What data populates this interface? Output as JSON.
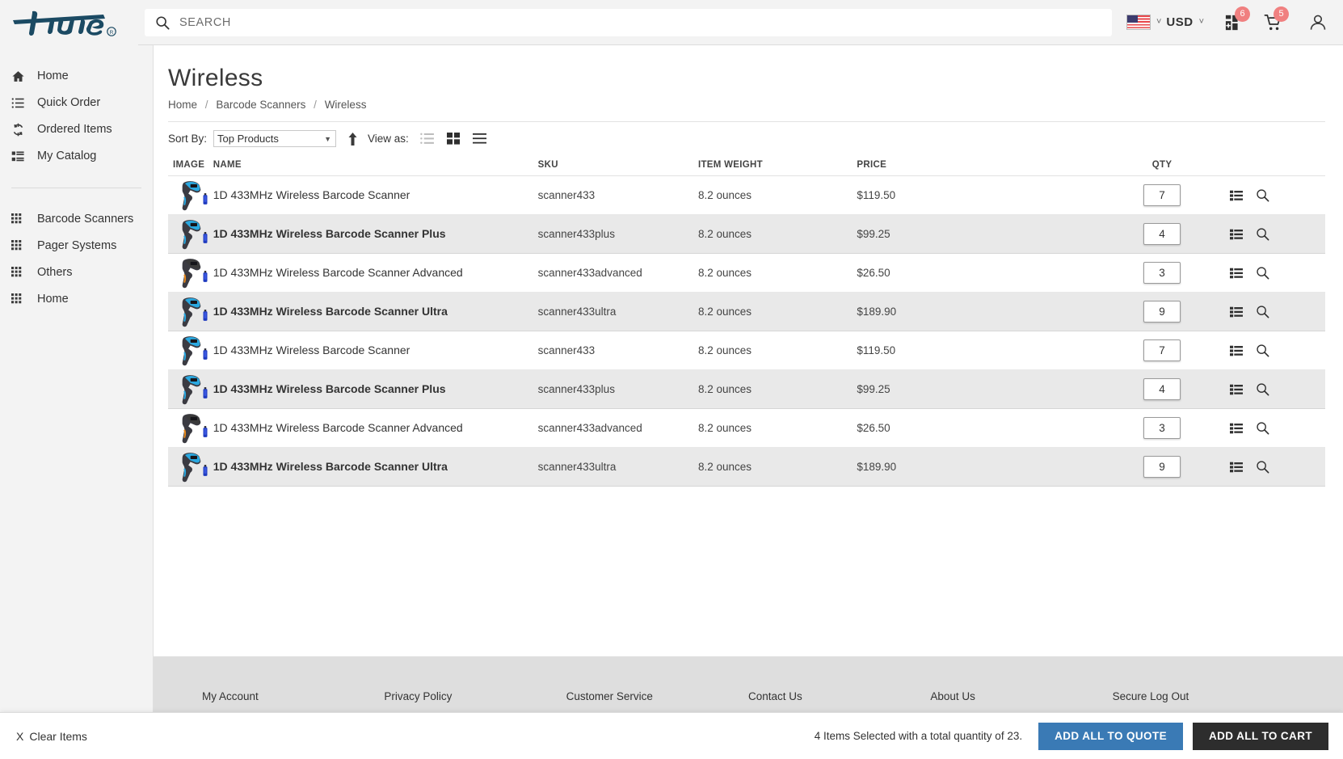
{
  "header": {
    "logo_text": "true",
    "search": {
      "placeholder": "SEARCH",
      "value": "",
      "icon": "search-icon"
    },
    "locale": {
      "flag": "us-flag-icon",
      "caret": "˅"
    },
    "currency": {
      "label": "USD",
      "caret": "˅"
    },
    "quote_badge": "6",
    "cart_badge": "5",
    "icons": {
      "quote": "quote-list-icon",
      "cart": "shopping-cart-icon",
      "account": "user-account-icon"
    }
  },
  "sidebar": {
    "group1": [
      {
        "label": "Home",
        "icon": "home-icon"
      },
      {
        "label": "Quick Order",
        "icon": "list-ul-icon"
      },
      {
        "label": "Ordered Items",
        "icon": "refresh-cycle-icon"
      },
      {
        "label": "My Catalog",
        "icon": "catalog-list-icon"
      }
    ],
    "group2": [
      {
        "label": "Barcode Scanners",
        "icon": "grid-dots-icon"
      },
      {
        "label": "Pager Systems",
        "icon": "grid-dots-icon"
      },
      {
        "label": "Others",
        "icon": "grid-dots-icon"
      },
      {
        "label": "Home",
        "icon": "grid-dots-icon"
      }
    ]
  },
  "main": {
    "title": "Wireless",
    "breadcrumb": [
      "Home",
      "Barcode Scanners",
      "Wireless"
    ],
    "breadcrumb_sep": "/",
    "toolbar": {
      "sort_by_label": "Sort By:",
      "sort_value": "Top Products",
      "sort_options": [
        "Top Products"
      ],
      "sort_caret": "▼",
      "sort_direction": "ascending",
      "view_as_label": "View as:",
      "views": [
        "list-view-icon",
        "grid-view-icon",
        "table-view-icon"
      ]
    },
    "columns": [
      "IMAGE",
      "NAME",
      "SKU",
      "ITEM WEIGHT",
      "PRICE",
      "QTY"
    ],
    "rows": [
      {
        "name": "1D 433MHz Wireless Barcode Scanner",
        "sku": "scanner433",
        "weight": "8.2 ounces",
        "price": "$119.50",
        "qty": "7",
        "selected": false,
        "thumb": "scanner-blue"
      },
      {
        "name": "1D 433MHz Wireless Barcode Scanner Plus",
        "sku": "scanner433plus",
        "weight": "8.2 ounces",
        "price": "$99.25",
        "qty": "4",
        "selected": true,
        "thumb": "scanner-blue"
      },
      {
        "name": "1D 433MHz Wireless Barcode Scanner Advanced",
        "sku": "scanner433advanced",
        "weight": "8.2 ounces",
        "price": "$26.50",
        "qty": "3",
        "selected": false,
        "thumb": "scanner-orange"
      },
      {
        "name": "1D 433MHz Wireless Barcode Scanner Ultra",
        "sku": "scanner433ultra",
        "weight": "8.2 ounces",
        "price": "$189.90",
        "qty": "9",
        "selected": true,
        "thumb": "scanner-blue"
      },
      {
        "name": "1D 433MHz Wireless Barcode Scanner",
        "sku": "scanner433",
        "weight": "8.2 ounces",
        "price": "$119.50",
        "qty": "7",
        "selected": false,
        "thumb": "scanner-blue"
      },
      {
        "name": "1D 433MHz Wireless Barcode Scanner Plus",
        "sku": "scanner433plus",
        "weight": "8.2 ounces",
        "price": "$99.25",
        "qty": "4",
        "selected": true,
        "thumb": "scanner-blue"
      },
      {
        "name": "1D 433MHz Wireless Barcode Scanner Advanced",
        "sku": "scanner433advanced",
        "weight": "8.2 ounces",
        "price": "$26.50",
        "qty": "3",
        "selected": false,
        "thumb": "scanner-orange"
      },
      {
        "name": "1D 433MHz Wireless Barcode Scanner Ultra",
        "sku": "scanner433ultra",
        "weight": "8.2 ounces",
        "price": "$189.90",
        "qty": "9",
        "selected": true,
        "thumb": "scanner-blue"
      }
    ],
    "row_actions": [
      "add-to-list-icon",
      "quick-view-icon"
    ]
  },
  "footer": {
    "links": [
      "My Account",
      "Privacy Policy",
      "Customer Service",
      "Contact Us",
      "About Us",
      "Secure Log Out"
    ]
  },
  "actionbar": {
    "clear_icon": "X",
    "clear_label": "Clear Items",
    "summary": "4 Items Selected with a total quantity of 23.",
    "quote_button": "ADD ALL TO QUOTE",
    "cart_button": "ADD ALL TO CART"
  },
  "colors": {
    "logo": "#1b4a63",
    "accent_blue": "#3a7ab5",
    "cart_dark": "#2d2d2d",
    "badge": "#f08080",
    "row_selected": "#e9e9e9",
    "sidebar_bg": "#f3f3f3",
    "footer_bg": "#dedede"
  }
}
